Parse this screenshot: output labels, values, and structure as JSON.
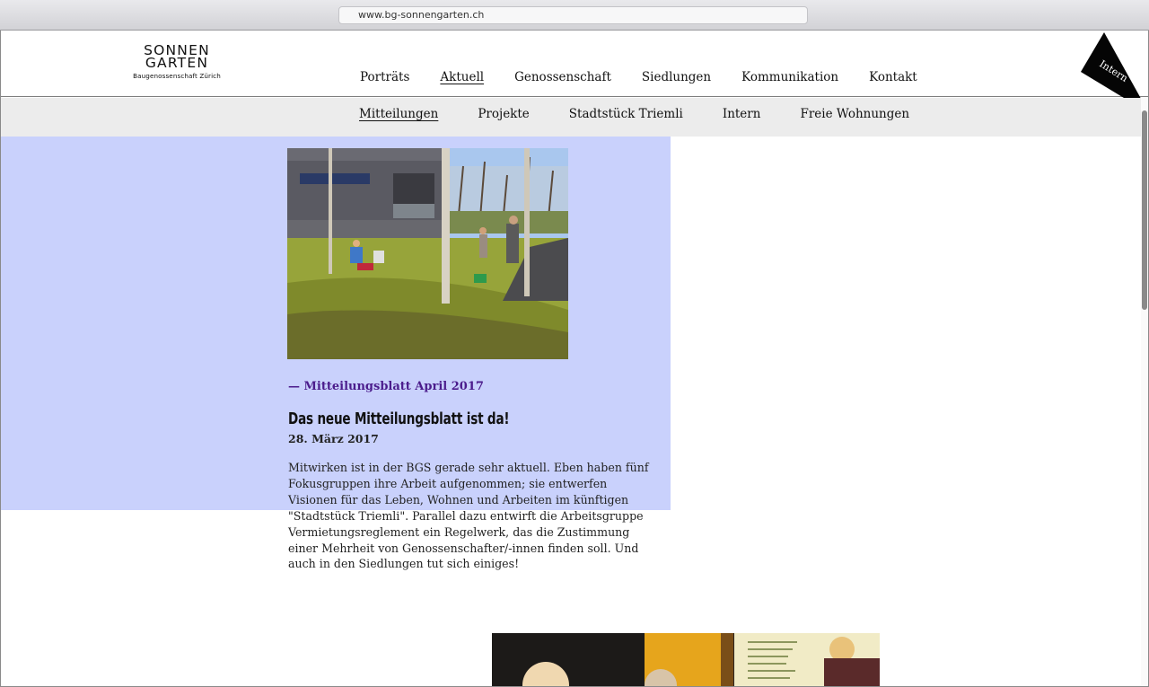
{
  "browser": {
    "url": "www.bg-sonnengarten.ch"
  },
  "logo": {
    "line1": "SONNEN",
    "line2": "GARTEN",
    "tagline": "Baugenossenschaft Zürich"
  },
  "main_nav": [
    {
      "label": "Porträts",
      "active": false
    },
    {
      "label": "Aktuell",
      "active": true
    },
    {
      "label": "Genossenschaft",
      "active": false
    },
    {
      "label": "Siedlungen",
      "active": false
    },
    {
      "label": "Kommunikation",
      "active": false
    },
    {
      "label": "Kontakt",
      "active": false
    }
  ],
  "intern_label": "Intern",
  "sub_nav": [
    {
      "label": "Mitteilungen",
      "active": true
    },
    {
      "label": "Projekte",
      "active": false
    },
    {
      "label": "Stadtstück Triemli",
      "active": false
    },
    {
      "label": "Intern",
      "active": false
    },
    {
      "label": "Freie Wohnungen",
      "active": false
    }
  ],
  "article": {
    "tagline": "— Mitteilungsblatt April 2017",
    "headline": "Das neue Mitteilungsblatt ist da!",
    "date": "28. März 2017",
    "body": "Mitwirken ist in der BGS gerade sehr aktuell. Eben haben fünf Fokusgruppen ihre Arbeit aufgenommen; sie entwerfen Visionen für das Leben, Wohnen und Arbeiten im künftigen \"Stadtstück Triemli\". Parallel dazu entwirft die Arbeitsgruppe Vermietungsreglement ein Regelwerk, das die Zustimmung einer Mehrheit von Genossenschafter/-innen finden soll. Und auch in den Siedlungen tut sich einiges!"
  },
  "colors": {
    "highlight": "#c9d1fc",
    "accent": "#4b1c8c",
    "subnav_bg": "#ececec"
  }
}
